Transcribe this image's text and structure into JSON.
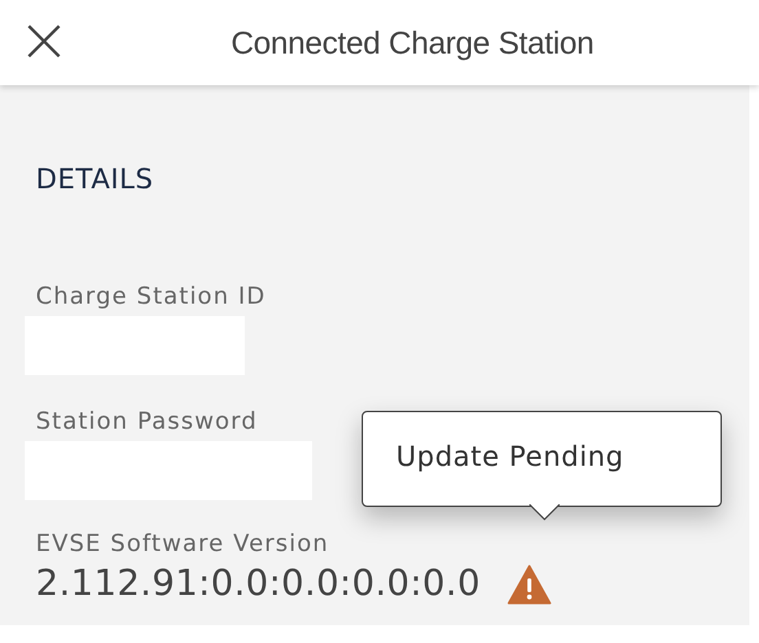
{
  "header": {
    "title": "Connected Charge Station"
  },
  "section": {
    "heading": "DETAILS"
  },
  "fields": [
    {
      "label": "Charge Station ID",
      "kind": "field"
    },
    {
      "label": "Station Password",
      "kind": "field"
    },
    {
      "label": "EVSE Software Version",
      "kind": "text",
      "value": "2.112.91:0.0:0.0:0.0:0.0",
      "warning": true
    }
  ],
  "tooltip": {
    "text": "Update Pending"
  }
}
